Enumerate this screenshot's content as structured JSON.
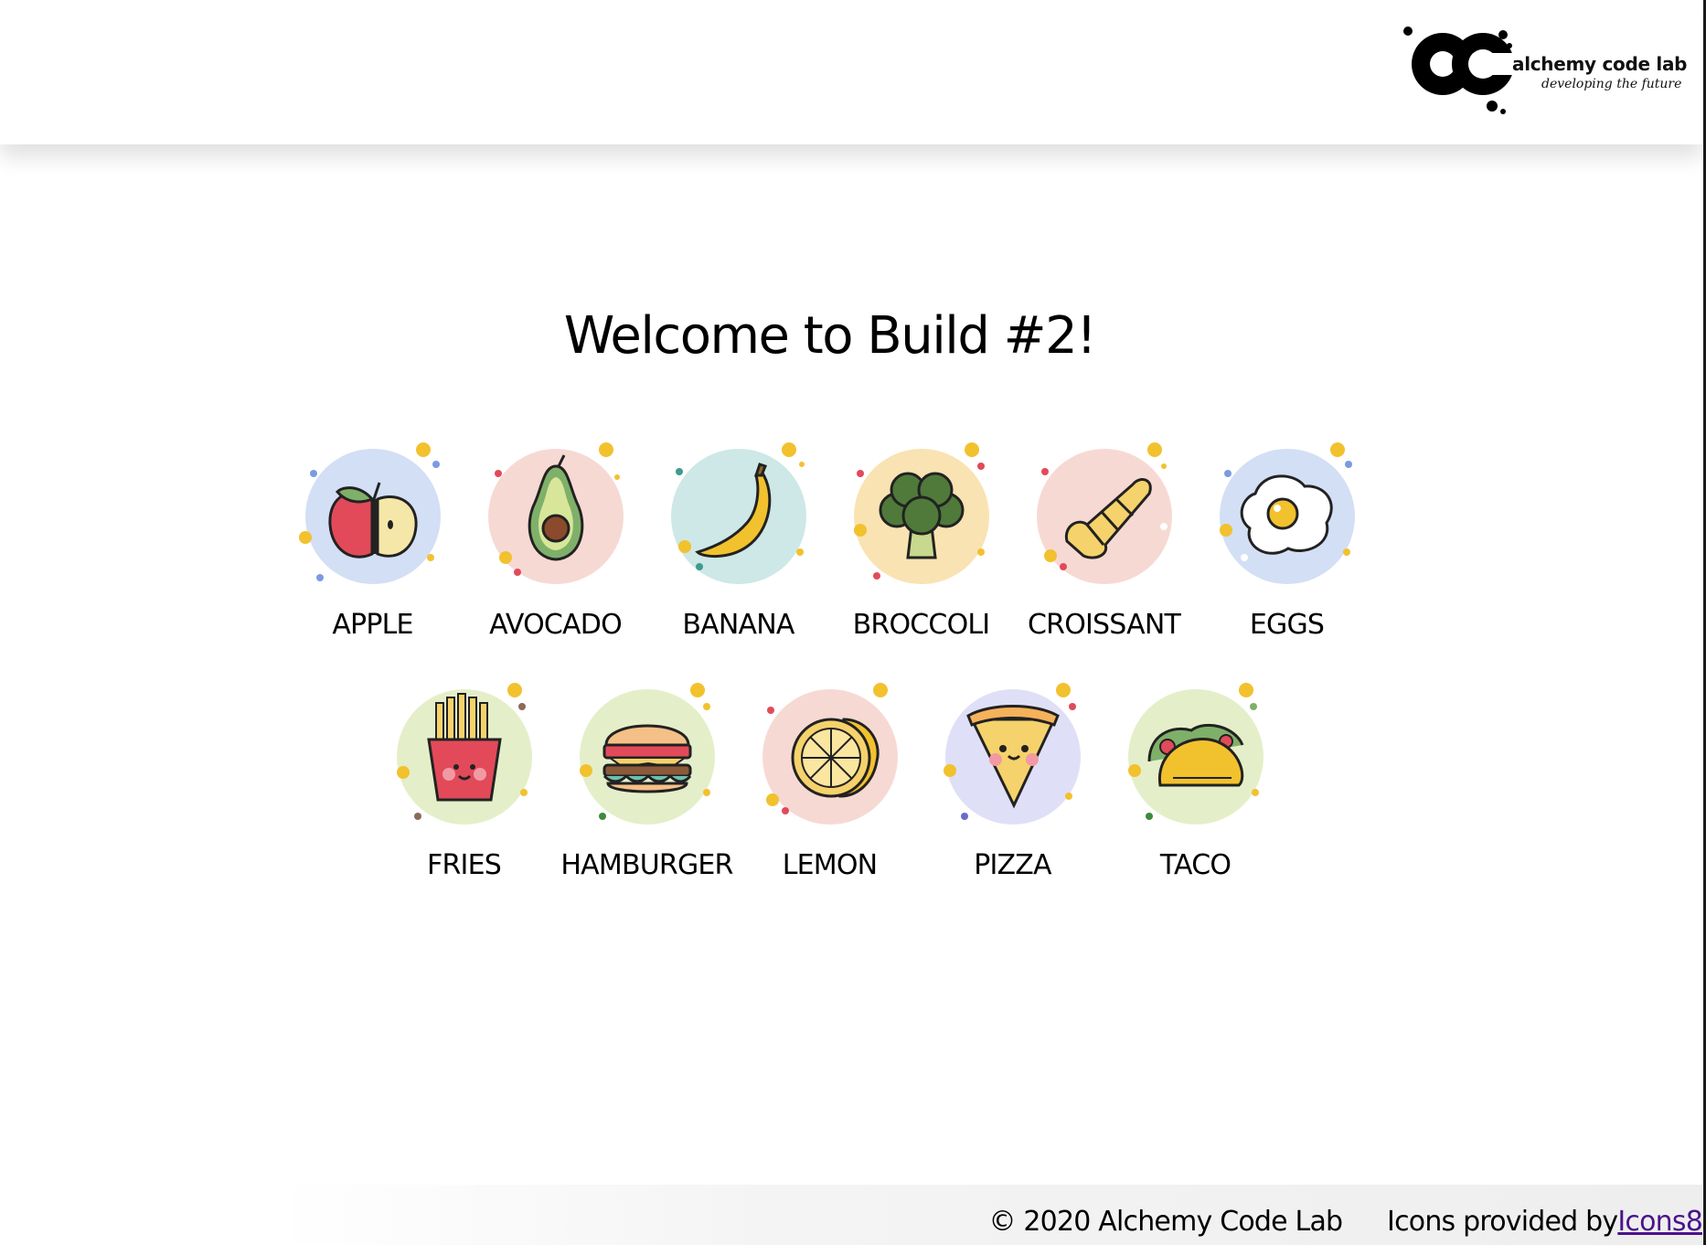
{
  "header": {
    "logo": {
      "name": "alchemy code lab",
      "tagline": "developing the future"
    }
  },
  "main": {
    "title": "Welcome to Build #2!",
    "items": [
      {
        "label": "APPLE",
        "icon": "apple-icon",
        "circle_color": "#d3dff5"
      },
      {
        "label": "AVOCADO",
        "icon": "avocado-icon",
        "circle_color": "#f7d9d3"
      },
      {
        "label": "BANANA",
        "icon": "banana-icon",
        "circle_color": "#cde8e6"
      },
      {
        "label": "BROCCOLI",
        "icon": "broccoli-icon",
        "circle_color": "#f9e3b2"
      },
      {
        "label": "CROISSANT",
        "icon": "croissant-icon",
        "circle_color": "#f7d9d3"
      },
      {
        "label": "EGGS",
        "icon": "egg-icon",
        "circle_color": "#d3dff5"
      },
      {
        "label": "FRIES",
        "icon": "fries-icon",
        "circle_color": "#e4efc9"
      },
      {
        "label": "HAMBURGER",
        "icon": "hamburger-icon",
        "circle_color": "#e4efc9"
      },
      {
        "label": "LEMON",
        "icon": "lemon-icon",
        "circle_color": "#f7d9d3"
      },
      {
        "label": "PIZZA",
        "icon": "pizza-icon",
        "circle_color": "#dfe0f7"
      },
      {
        "label": "TACO",
        "icon": "taco-icon",
        "circle_color": "#e4efc9"
      }
    ]
  },
  "footer": {
    "copyright": "© 2020 Alchemy Code Lab",
    "credit_prefix": "Icons provided by",
    "credit_link": "Icons8"
  },
  "colors": {
    "link": "#4a148c",
    "accent_dot": "#f2c12e"
  }
}
